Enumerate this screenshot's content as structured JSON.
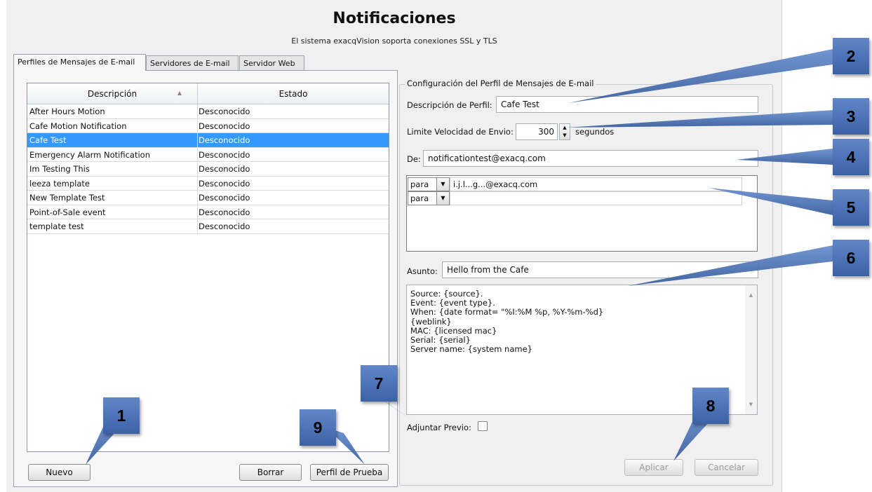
{
  "header": {
    "title": "Notificaciones",
    "subtitle": "El sistema exacqVision soporta conexiones SSL y TLS"
  },
  "tabs": [
    {
      "label": "Perfiles de Mensajes de E-mail",
      "active": true
    },
    {
      "label": "Servidores de E-mail",
      "active": false
    },
    {
      "label": "Servidor Web",
      "active": false
    }
  ],
  "profiles_table": {
    "headers": [
      "Descripción",
      "Estado"
    ],
    "sort_indicator": "▲",
    "rows": [
      {
        "description": "After Hours Motion",
        "status": "Desconocido"
      },
      {
        "description": "Cafe Motion Notification",
        "status": "Desconocido"
      },
      {
        "description": "Cafe Test",
        "status": "Desconocido",
        "selected": true
      },
      {
        "description": "Emergency Alarm Notification",
        "status": "Desconocido"
      },
      {
        "description": "Im Testing This",
        "status": "Desconocido"
      },
      {
        "description": "leeza template",
        "status": "Desconocido"
      },
      {
        "description": "New Template Test",
        "status": "Desconocido"
      },
      {
        "description": "Point-of-Sale event",
        "status": "Desconocido"
      },
      {
        "description": "template test",
        "status": "Desconocido"
      }
    ]
  },
  "left_buttons": {
    "new": "Nuevo",
    "delete": "Borrar",
    "test": "Perfil de Prueba"
  },
  "config": {
    "group_title": "Configuración del Perfil de Mensajes de E-mail",
    "description_label": "Descripción de Perfil:",
    "description_value": "Cafe Test",
    "rate_label": "Limite Velocidad de Envio:",
    "rate_value": "300",
    "rate_unit": "segundos",
    "from_label": "De:",
    "from_value": "notificationtest@exacq.com",
    "recipients": [
      {
        "type": "para",
        "address": "i.j.l...g...@exacq.com"
      },
      {
        "type": "para",
        "address": ""
      }
    ],
    "subject_label": "Asunto:",
    "subject_value": "Hello from the Cafe",
    "body_lines": [
      "Source: {source}.",
      "Event: {event type}.",
      "When: {date format= \"%I:%M %p, %Y-%m-%d}",
      "{weblink}",
      "MAC: {licensed mac}",
      "Serial: {serial}",
      "Server name: {system name}"
    ],
    "attach_label": "Adjuntar Previo:",
    "attach_checked": false,
    "apply": "Aplicar",
    "cancel": "Cancelar"
  },
  "callouts": [
    "1",
    "2",
    "3",
    "4",
    "5",
    "6",
    "7",
    "8",
    "9"
  ],
  "colors": {
    "selection": "#3399ff",
    "callout": "#4a72b8"
  }
}
